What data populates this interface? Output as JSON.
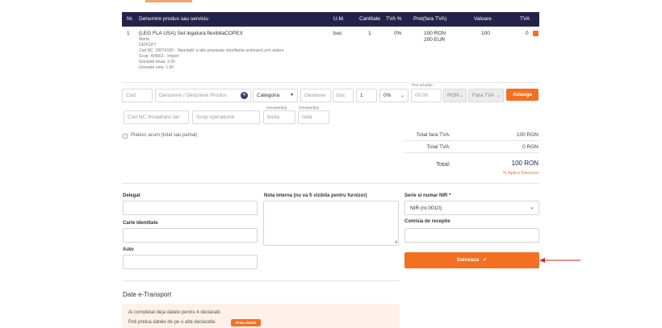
{
  "header": {
    "nr": "Nr.",
    "produs": "Denumire produs sau serviciu",
    "um": "U.M.",
    "cantitate": "Cantitate",
    "tva_pct": "TVA %",
    "pret": "Pret(fara TVA)",
    "valoare": "Valoare",
    "tva": "TVA"
  },
  "item": {
    "nr": "1",
    "name": "(LEG FLA USA) Set legatura flexibilaCOPEX",
    "marca": "Marfa",
    "depozit": "DEPOZIT",
    "cod_nc": "Cod NC: 33074100 - 'Aparitatti' si alte preparate odorifiante actionand prin ardere",
    "scop": "Scop: 404001 - Import",
    "greutate_bruta": "Greutate bruta: 1.00",
    "greutate_neta": "Greutate neta: 1.00",
    "um": "buc",
    "cantitate": "1",
    "tva_pct": "0%",
    "pret_ron": "100 RON",
    "pret_eur": "200 EUR",
    "valoare": "100",
    "tva": "0"
  },
  "add_row": {
    "cod_placeholder": "Cod",
    "denumire_placeholder": "Denumire / Descriere Produs",
    "categoria": "Categoria",
    "gestiune_placeholder": "Gestiune",
    "um_value": "buc",
    "cantitate_value": "1",
    "tva_value": "0%",
    "pret_label": "Pret achizitie",
    "pret_value": "00.00",
    "currency": "RON",
    "fara_tva": "Fara TVA",
    "adauga": "Adauga",
    "cod_nc_placeholder": "Cod NC /incadrare tari",
    "scop_placeholder": "Scop operatiune",
    "greutate_bruta_label": "Greutate(kg)",
    "greutate_bruta_placeholder": "bruta",
    "greutate_neta_label": "Greutate(kg)",
    "greutate_neta_placeholder": "neta"
  },
  "platesc_acum": "Platesc acum (total sau partial)",
  "totals": {
    "total_fara_tva_label": "Total fara TVA:",
    "total_fara_tva": "100 RON",
    "total_tva_label": "Total TVA:",
    "total_tva": "0 RON",
    "total_label": "Total:",
    "total": "100 RON",
    "aplica_discount": "% Aplica Discount"
  },
  "form": {
    "delegat_label": "Delegat",
    "carte_identitate_label": "Carte Identitate",
    "auto_label": "Auto",
    "nota_interna_label": "Nota interna (nu va fi vizibila pentru furnizor)",
    "serie_label": "Serie si numar NIR *",
    "serie_value": "NIR (nr.0010)",
    "comisie_label": "Comisia de receptie",
    "salveaza": "Salveaza"
  },
  "etransport": {
    "title": "Date e-Transport",
    "line1": "Ai completat deja datele pentru 4 declaratii.",
    "line2": "Poti prelua datele de pe o alta declaratie.",
    "preia_btn": "Preia datele"
  },
  "colors": {
    "header_bg": "#23234a",
    "accent": "#f37021",
    "annotation_arrow": "#d9231f",
    "etransport_bg": "#fdf1ea"
  }
}
